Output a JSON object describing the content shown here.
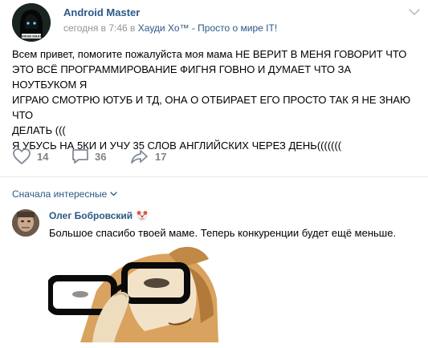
{
  "post": {
    "author": "Android Master",
    "avatar_caption": "ANDROID MASTER",
    "time": "сегодня в 7:46 в",
    "community": "Хауди Хо™ - Просто о мире IT!",
    "text_lines": [
      "Всем привет, помогите пожалуйста моя мама НЕ ВЕРИТ В МЕНЯ ГОВОРИТ ЧТО",
      "ЭТО ВСЁ ПРОГРАММИРОВАНИЕ ФИГНЯ ГОВНО И ДУМАЕТ ЧТО ЗА НОУТБУКОМ Я",
      "ИГРАЮ СМОТРЮ ЮТУБ И ТД, ОНА О ОТБИРАЕТ ЕГО ПРОСТО ТАК Я НЕ ЗНАЮ ЧТО",
      "ДЕЛАТЬ (((",
      "Я УБУСЬ НА 5КИ И УЧУ 35 СЛОВ АНГЛИЙСКИХ ЧЕРЕЗ ДЕНЬ((((((("
    ],
    "likes": "14",
    "comments": "36",
    "shares": "17",
    "menu_icon": "chevron-down-icon"
  },
  "comments_section": {
    "sort_label": "Сначала интересные",
    "comment": {
      "author": "Олег Бобровский",
      "badge_icon": "clown-emoji",
      "text": "Большое спасибо твоей маме. Теперь конкуренции будет ещё меньше.",
      "image_desc": "meme-dog-with-glasses"
    }
  },
  "colors": {
    "link": "#2a5885",
    "meta": "#939393",
    "icon": "#828a99",
    "count": "#828282",
    "divider": "#e7e8ec"
  }
}
